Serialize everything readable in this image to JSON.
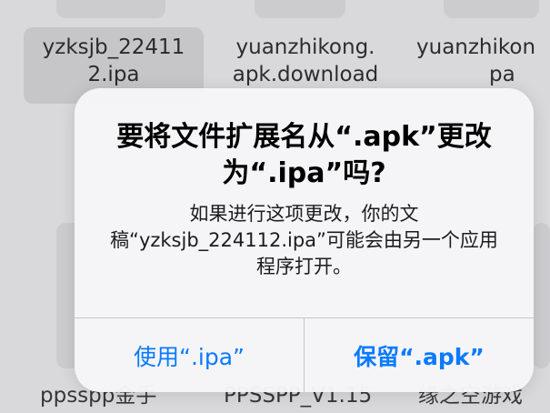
{
  "files_top": [
    {
      "line1": "yzksjb_22411",
      "line2": "2.ipa",
      "selected": true
    },
    {
      "line1": "yuanzhikong.",
      "line2": "apk.download",
      "selected": false
    },
    {
      "line1": "yuanzhikon",
      "line2": "pa",
      "selected": false
    }
  ],
  "files_bottom": [
    {
      "name": "ppsspp金手"
    },
    {
      "name": "PPSSPP_V1.15"
    },
    {
      "name": "缘之空游戏"
    }
  ],
  "alert": {
    "title": "要将文件扩展名从“.apk”更改为“.ipa”吗?",
    "message": "如果进行这项更改，你的文稿“yzksjb_224112.ipa”可能会由另一个应用程序打开。",
    "buttons": {
      "use_ipa": "使用“.ipa”",
      "keep_apk": "保留“.apk”"
    }
  },
  "colors": {
    "accent": "#0a7aff",
    "background": "#e7e7e9"
  }
}
